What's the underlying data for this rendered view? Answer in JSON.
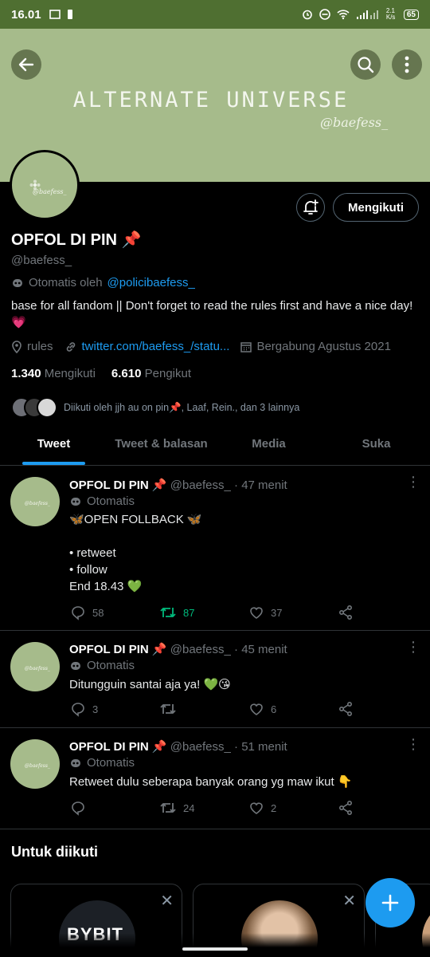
{
  "status_bar": {
    "time": "16.01",
    "speed": "2.1 K/s",
    "battery": "65"
  },
  "banner": {
    "title": "ALTERNATE UNIVERSE",
    "subtitle": "@baefess_",
    "color": "#a6bb8b"
  },
  "avatar": {
    "mini_text": "@baefess_"
  },
  "profile": {
    "follow_button": "Mengikuti",
    "name": "OPFOL DI PIN 📌",
    "handle": "@baefess_",
    "automated_prefix": "Otomatis oleh",
    "automated_account": "@policibaefess_",
    "bio": "base for all fandom || Don't forget to read the rules first and have a nice day!💗",
    "location": "rules",
    "website": "twitter.com/baefess_/statu...",
    "joined": "Bergabung Agustus 2021",
    "following_count": "1.340",
    "following_label": "Mengikuti",
    "followers_count": "6.610",
    "followers_label": "Pengikut",
    "followed_by": "Diikuti oleh jjh au on pin📌, Laaf, Rein., dan 3 lainnya"
  },
  "tabs": [
    {
      "label": "Tweet",
      "active": true
    },
    {
      "label": "Tweet & balasan",
      "active": false
    },
    {
      "label": "Media",
      "active": false
    },
    {
      "label": "Suka",
      "active": false
    }
  ],
  "tweets": [
    {
      "name": "OPFOL DI PIN 📌",
      "handle": "@baefess_",
      "time": "· 47 menit",
      "automated": "Otomatis",
      "lines": [
        "🦋OPEN FOLLBACK 🦋",
        "",
        "• retweet",
        "• follow",
        "End 18.43 💚"
      ],
      "replies": "58",
      "retweets": "87",
      "likes": "37"
    },
    {
      "name": "OPFOL DI PIN 📌",
      "handle": "@baefess_",
      "time": "· 45 menit",
      "automated": "Otomatis",
      "lines": [
        "Ditungguin santai aja ya! 💚😘"
      ],
      "replies": "3",
      "retweets": "",
      "likes": "6"
    },
    {
      "name": "OPFOL DI PIN 📌",
      "handle": "@baefess_",
      "time": "· 51 menit",
      "automated": "Otomatis",
      "lines": [
        "Retweet dulu seberapa banyak orang yg maw ikut 👇"
      ],
      "replies": "",
      "retweets": "24",
      "likes": "2"
    }
  ],
  "suggestions": {
    "title": "Untuk diikuti",
    "card1_logo": "BYBIT"
  },
  "colors": {
    "accent": "#1d9bf0",
    "retweet_active": "#00ba7c",
    "status_bar": "#4f6f31"
  }
}
